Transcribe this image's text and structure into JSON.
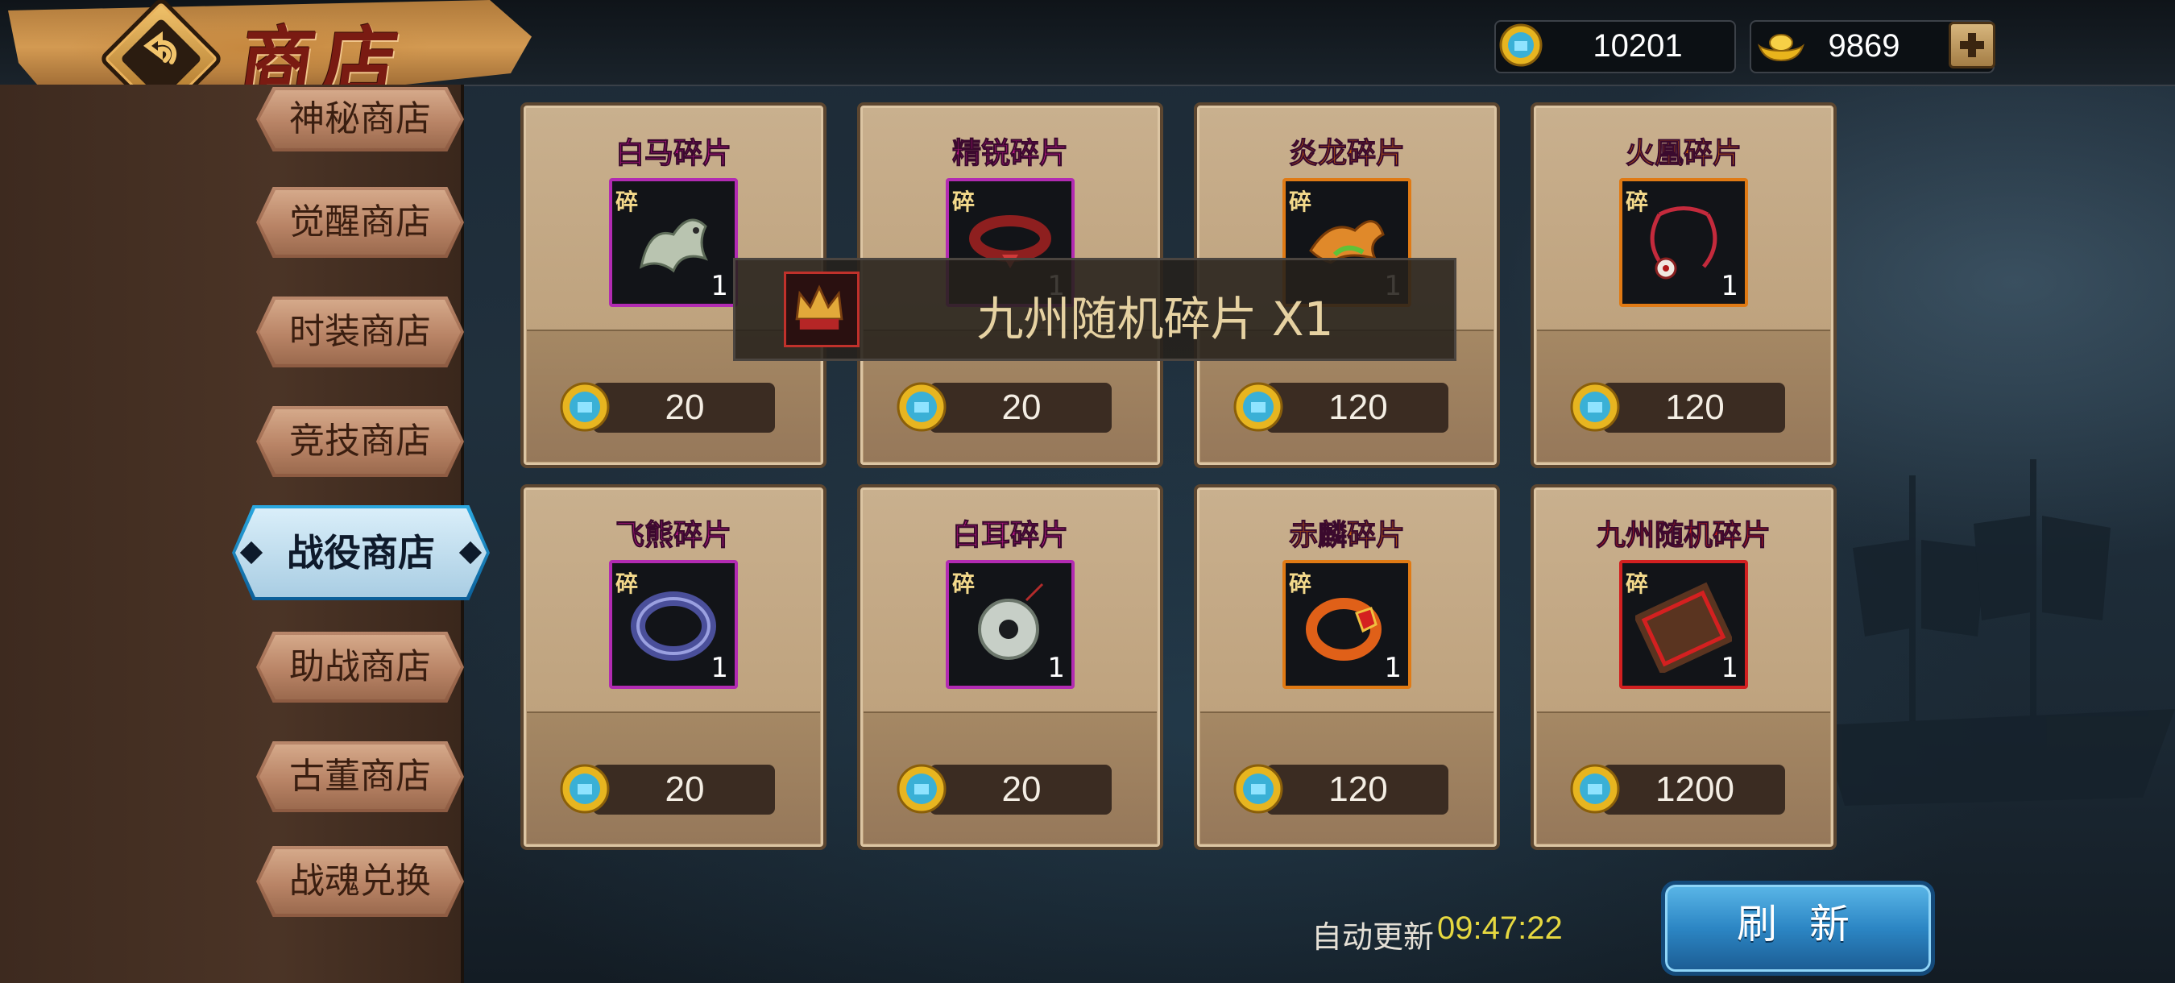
{
  "header": {
    "title": "商店",
    "coins": "10201",
    "ingots": "9869"
  },
  "sidebar": {
    "tabs": [
      {
        "label": "神秘商店"
      },
      {
        "label": "觉醒商店"
      },
      {
        "label": "时装商店"
      },
      {
        "label": "竞技商店"
      },
      {
        "label": "战役商店",
        "active": true
      },
      {
        "label": "助战商店"
      },
      {
        "label": "古董商店"
      },
      {
        "label": "战魂兑换"
      }
    ]
  },
  "items": [
    {
      "name": "白马碎片",
      "shard": "碎",
      "qty": "1",
      "price": "20",
      "color": "#c2168c",
      "frame": "#b22bb2"
    },
    {
      "name": "精锐碎片",
      "shard": "碎",
      "qty": "1",
      "price": "20",
      "color": "#c2168c",
      "frame": "#b22bb2"
    },
    {
      "name": "炎龙碎片",
      "shard": "碎",
      "qty": "1",
      "price": "120",
      "color": "#c65d0c",
      "frame": "#e07a14"
    },
    {
      "name": "火凰碎片",
      "shard": "碎",
      "qty": "1",
      "price": "120",
      "color": "#c65d0c",
      "frame": "#e07a14"
    },
    {
      "name": "飞熊碎片",
      "shard": "碎",
      "qty": "1",
      "price": "20",
      "color": "#c2168c",
      "frame": "#b22bb2"
    },
    {
      "name": "白耳碎片",
      "shard": "碎",
      "qty": "1",
      "price": "20",
      "color": "#c2168c",
      "frame": "#b22bb2"
    },
    {
      "name": "赤麟碎片",
      "shard": "碎",
      "qty": "1",
      "price": "120",
      "color": "#c65d0c",
      "frame": "#e07a14"
    },
    {
      "name": "九州随机碎片",
      "shard": "碎",
      "qty": "1",
      "price": "1200",
      "color": "#c81a1a",
      "frame": "#d22020"
    }
  ],
  "toast": {
    "message": "九州随机碎片 X1"
  },
  "footer": {
    "auto_refresh_label": "自动更新",
    "auto_refresh_time": "09:47:22",
    "refresh_button": "刷 新"
  }
}
